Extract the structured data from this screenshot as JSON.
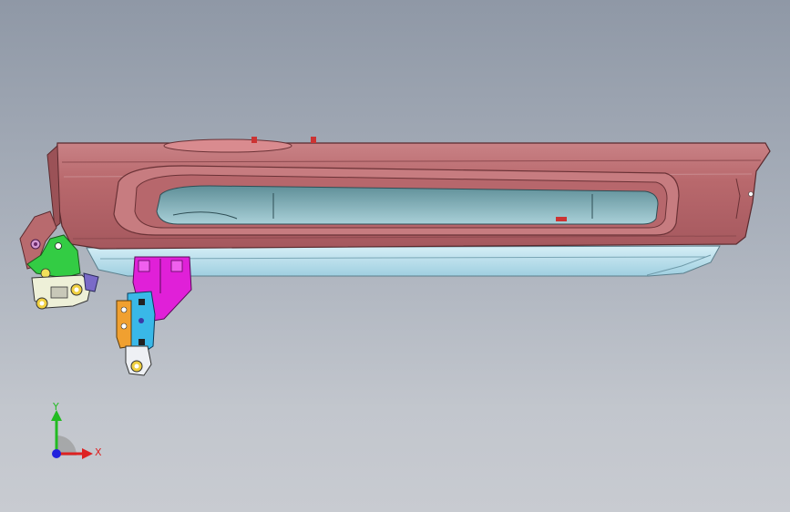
{
  "viewport": {
    "background_top": "#8f98a6",
    "background_bottom": "#c8cbd1"
  },
  "model": {
    "parts": [
      {
        "name": "door-trim-panel",
        "color": "#b86a6e"
      },
      {
        "name": "lower-trim-strip",
        "color": "#a9d8e6"
      },
      {
        "name": "bracket-green",
        "color": "#33cc44"
      },
      {
        "name": "bracket-magenta",
        "color": "#e020d8"
      },
      {
        "name": "hinge-blue",
        "color": "#39b8e8"
      },
      {
        "name": "latch-yellow",
        "color": "#f0d040"
      }
    ]
  },
  "triad": {
    "y_label": "Y",
    "x_label": "X",
    "y_color": "#22bb22",
    "x_color": "#dd2222",
    "z_color": "#2222dd"
  }
}
